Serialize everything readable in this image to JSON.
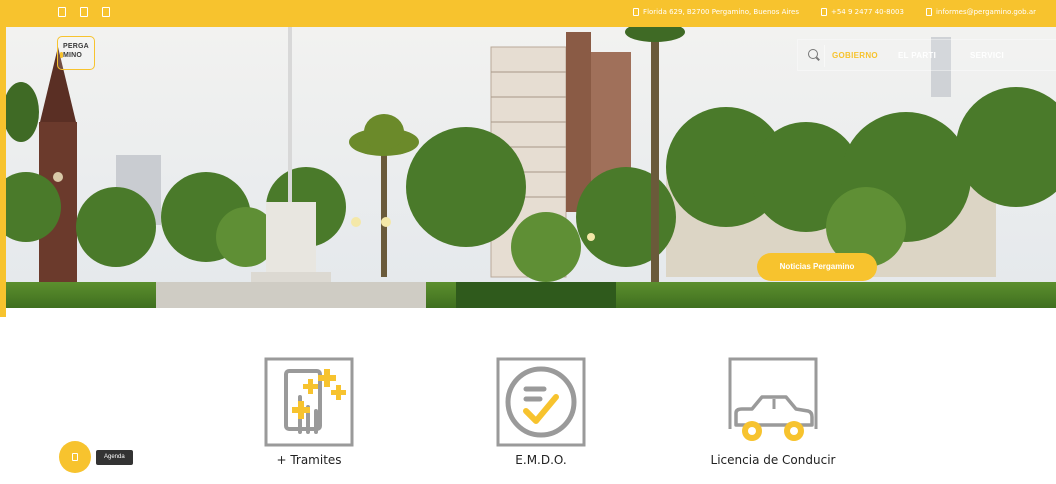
{
  "topbar": {
    "address": "Florida 629, B2700 Pergamino, Buenos Aires",
    "phone": "+54 9 2477 40-8003",
    "email": "informes@pergamino.gob.ar"
  },
  "logo": {
    "line1": "PERGA",
    "line2": "MINO"
  },
  "nav": {
    "items": [
      "GOBIERNO",
      "EL PARTI",
      "SERVICI"
    ]
  },
  "hero": {
    "button_label": "Noticias Pergamino"
  },
  "services": [
    {
      "label": "+ Tramites",
      "icon": "phone-tap-icon"
    },
    {
      "label": "E.M.D.O.",
      "icon": "checklist-icon"
    },
    {
      "label": "Licencia de Conducir",
      "icon": "car-icon"
    }
  ],
  "agenda": {
    "tooltip": "Agenda"
  },
  "colors": {
    "accent": "#f7c32e",
    "icon_gray": "#9a9a9a"
  }
}
